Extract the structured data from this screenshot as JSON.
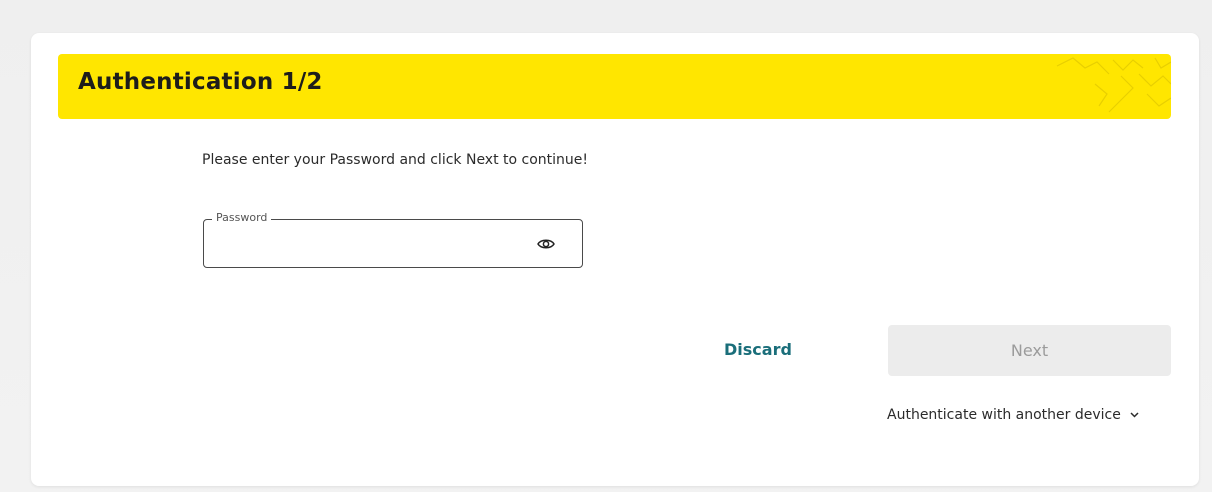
{
  "auth": {
    "title": "Authentication 1/2",
    "instruction": "Please enter your Password and click Next to continue!",
    "password_label": "Password",
    "password_value": "",
    "discard_label": "Discard",
    "next_label": "Next",
    "alt_auth_label": "Authenticate with another device"
  },
  "icons": {
    "password_toggle": "eye-icon",
    "alt_auth_toggle": "chevron-down-icon"
  },
  "colors": {
    "banner": "#ffe600",
    "discard_text": "#1a6e7a",
    "next_bg_disabled": "#ececec",
    "next_text_disabled": "#9b9b9b"
  }
}
